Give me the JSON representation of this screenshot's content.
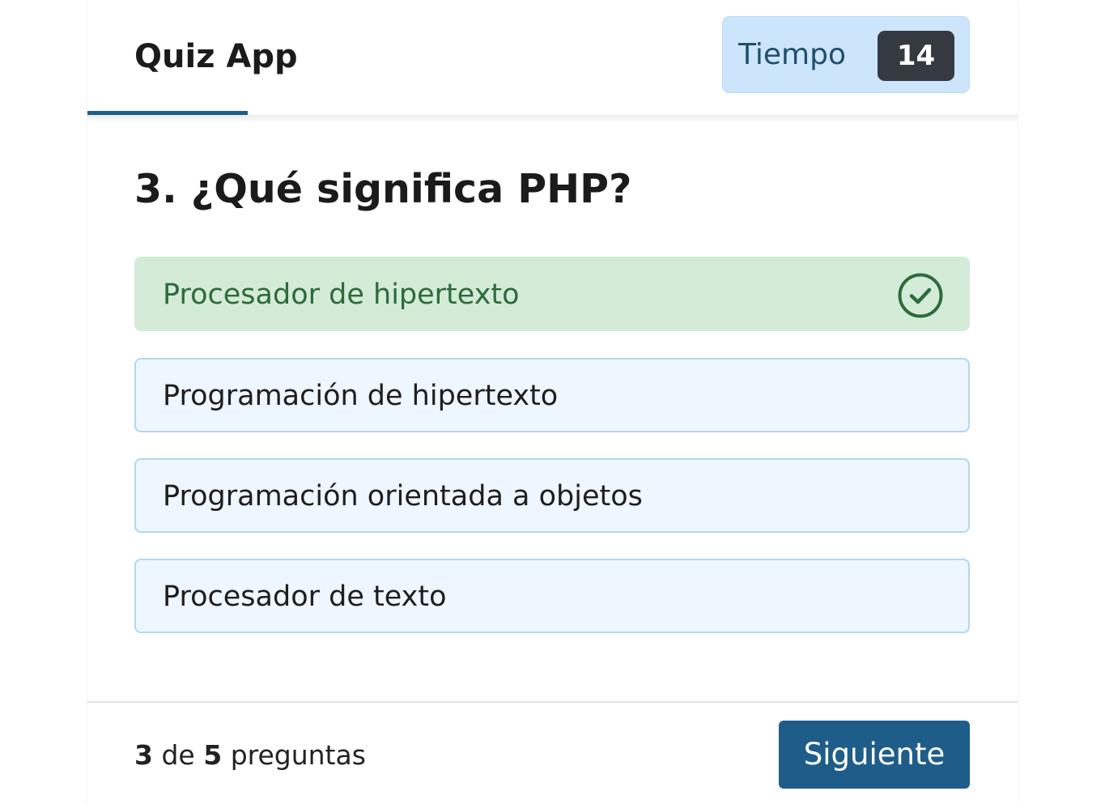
{
  "app": {
    "title": "Quiz App"
  },
  "timer": {
    "label": "Tiempo",
    "value": "14"
  },
  "progress": {
    "fraction": 0.6
  },
  "question": {
    "text": "3. ¿Qué significa PHP?"
  },
  "options": [
    {
      "label": "Procesador de hipertexto",
      "state": "correct",
      "icon": "check-circle-icon"
    },
    {
      "label": "Programación de hipertexto",
      "state": "default"
    },
    {
      "label": "Programación orientada a objetos",
      "state": "default"
    },
    {
      "label": "Procesador de texto",
      "state": "default"
    }
  ],
  "footer": {
    "current": "3",
    "of_text": "de",
    "total": "5",
    "suffix": "preguntas",
    "next_label": "Siguiente"
  },
  "colors": {
    "primary": "#1e5d89",
    "timer_bg": "#cce5fb",
    "correct_bg": "#d4ebd7",
    "correct_text": "#2c6b3c",
    "option_bg": "#eef6ff",
    "option_border": "#b3d6f2"
  }
}
